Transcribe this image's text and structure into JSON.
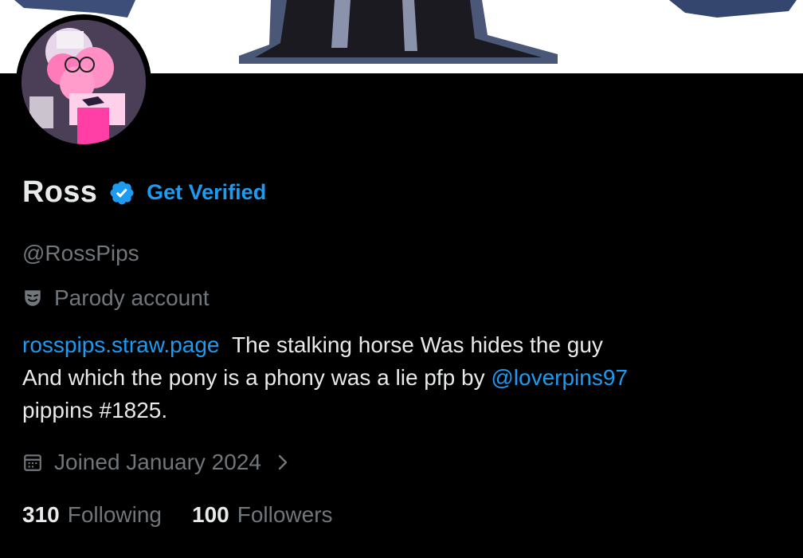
{
  "profile": {
    "display_name": "Ross",
    "get_verified_label": "Get Verified",
    "handle": "@RossPips",
    "parody_label": "Parody account",
    "bio": {
      "link_url_text": "rosspips.straw.page",
      "line1_text": "The stalking horse  Was hides the guy",
      "line2_text": "And which the pony is a phony was a lie   pfp by",
      "mention": "@loverpins97",
      "line3_text": "pippins #1825."
    },
    "joined": "Joined January 2024",
    "following_count": "310",
    "following_label": "Following",
    "followers_count": "100",
    "followers_label": "Followers"
  },
  "colors": {
    "background": "#000000",
    "primary_text": "#e7e9ea",
    "secondary_text": "#71767b",
    "accent": "#1d9bf0"
  },
  "icons": {
    "verified": "verified-badge-icon",
    "parody": "theater-mask-icon",
    "joined": "calendar-icon",
    "expand": "chevron-right-icon"
  }
}
